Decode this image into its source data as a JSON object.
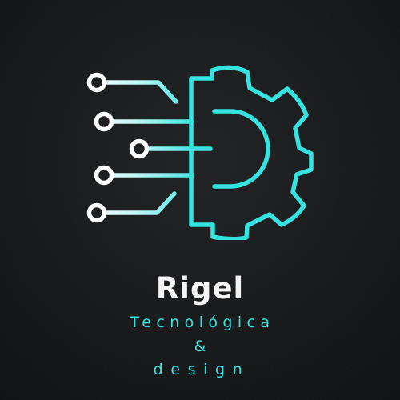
{
  "brand": {
    "name": "Rigel",
    "tagline_line1": "Tecnológica",
    "tagline_line2": "&",
    "tagline_line3": "design"
  },
  "colors": {
    "background": "#141516",
    "accent": "#35e3e1",
    "text": "#f4f4f4"
  },
  "icons": [
    "circuit-gear-icon"
  ]
}
